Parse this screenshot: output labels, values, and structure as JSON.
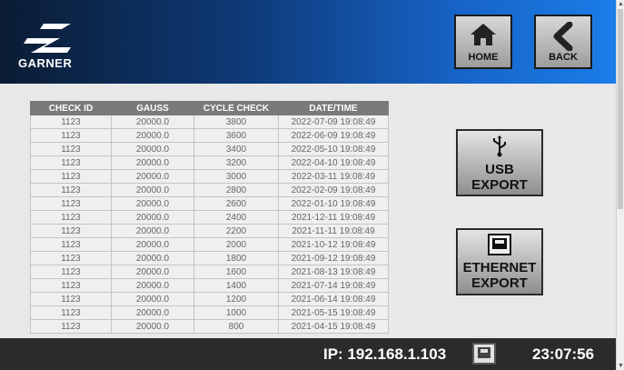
{
  "brand": {
    "name": "GARNER"
  },
  "nav": {
    "home_label": "HOME",
    "back_label": "BACK"
  },
  "table": {
    "headers": [
      "CHECK ID",
      "GAUSS",
      "CYCLE CHECK",
      "DATE/TIME"
    ],
    "rows": [
      [
        "1123",
        "20000.0",
        "3800",
        "2022-07-09 19:08:49"
      ],
      [
        "1123",
        "20000.0",
        "3600",
        "2022-06-09 19:08:49"
      ],
      [
        "1123",
        "20000.0",
        "3400",
        "2022-05-10 19:08:49"
      ],
      [
        "1123",
        "20000.0",
        "3200",
        "2022-04-10 19:08:49"
      ],
      [
        "1123",
        "20000.0",
        "3000",
        "2022-03-11 19:08:49"
      ],
      [
        "1123",
        "20000.0",
        "2800",
        "2022-02-09 19:08:49"
      ],
      [
        "1123",
        "20000.0",
        "2600",
        "2022-01-10 19:08:49"
      ],
      [
        "1123",
        "20000.0",
        "2400",
        "2021-12-11 19:08:49"
      ],
      [
        "1123",
        "20000.0",
        "2200",
        "2021-11-11 19:08:49"
      ],
      [
        "1123",
        "20000.0",
        "2000",
        "2021-10-12 19:08:49"
      ],
      [
        "1123",
        "20000.0",
        "1800",
        "2021-09-12 19:08:49"
      ],
      [
        "1123",
        "20000.0",
        "1600",
        "2021-08-13 19:08:49"
      ],
      [
        "1123",
        "20000.0",
        "1400",
        "2021-07-14 19:08:49"
      ],
      [
        "1123",
        "20000.0",
        "1200",
        "2021-06-14 19:08:49"
      ],
      [
        "1123",
        "20000.0",
        "1000",
        "2021-05-15 19:08:49"
      ],
      [
        "1123",
        "20000.0",
        "800",
        "2021-04-15 19:08:49"
      ]
    ]
  },
  "export": {
    "usb_line1": "USB",
    "usb_line2": "EXPORT",
    "eth_line1": "ETHERNET",
    "eth_line2": "EXPORT"
  },
  "status": {
    "ip": "IP: 192.168.1.103",
    "time": "23:07:56"
  },
  "icons": {
    "home": "home-icon",
    "back": "back-arrow-icon",
    "usb": "usb-icon",
    "ethernet": "ethernet-port-icon"
  }
}
